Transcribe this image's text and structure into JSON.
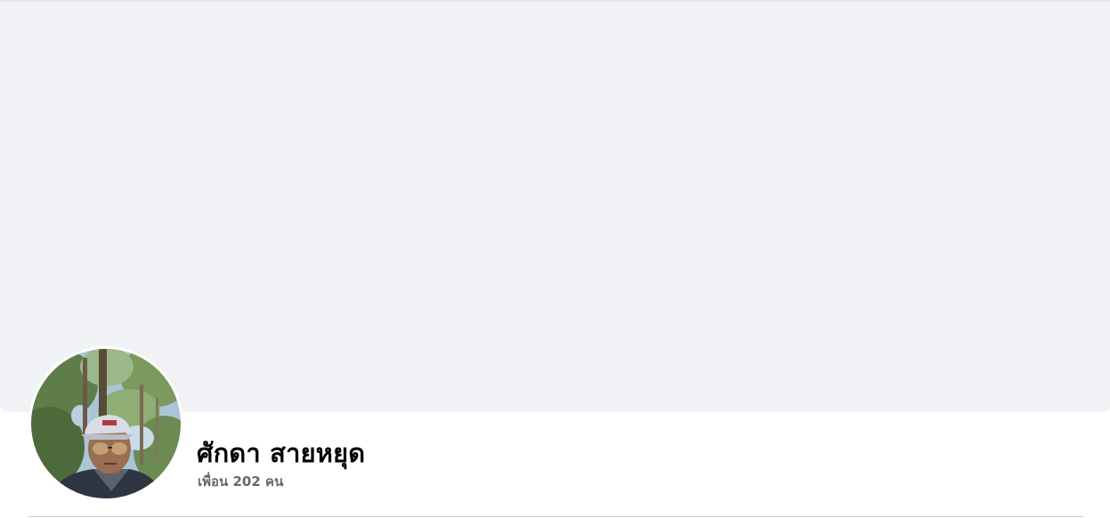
{
  "profile": {
    "name": "ศักดา สายหยุด",
    "friends_count_text": "เพื่อน 202 คน"
  },
  "icons": {
    "avatar": "profile-photo"
  },
  "colors": {
    "cover_background": "#f0f2f5",
    "name_text": "#050505",
    "secondary_text": "#65676b",
    "divider": "#ced0d4"
  }
}
